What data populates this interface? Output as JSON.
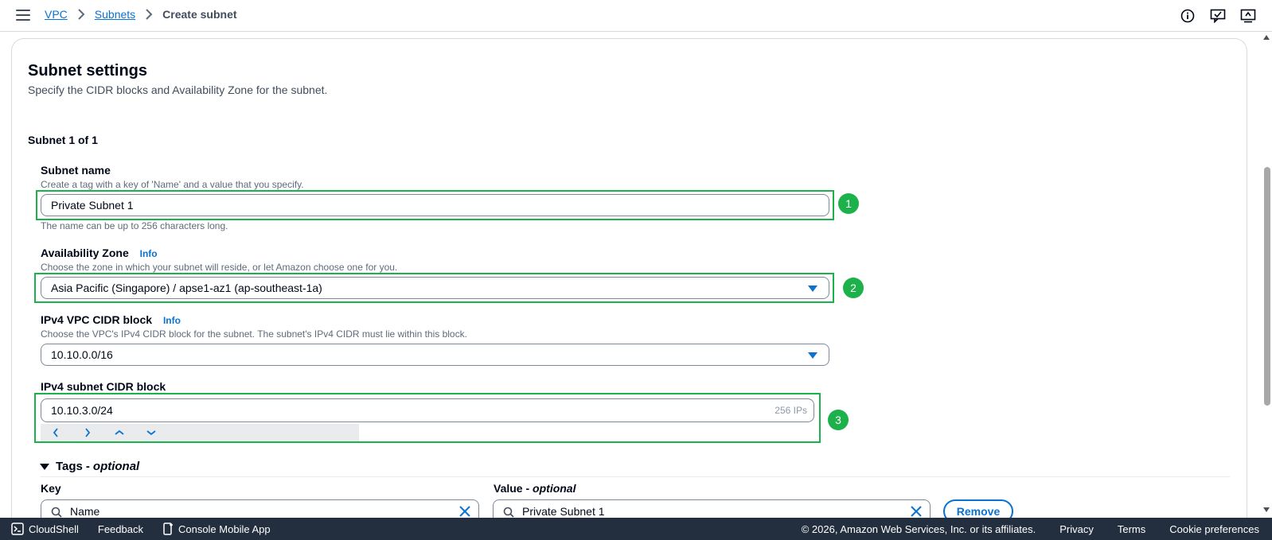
{
  "header": {
    "breadcrumb": {
      "vpc": "VPC",
      "subnets": "Subnets",
      "current": "Create subnet"
    },
    "icons": [
      "info-icon",
      "feedback-icon",
      "notifications-icon"
    ]
  },
  "section": {
    "title": "Subnet settings",
    "description": "Specify the CIDR blocks and Availability Zone for the subnet.",
    "subnet_count": "Subnet 1 of 1"
  },
  "subnet_name": {
    "label": "Subnet name",
    "description": "Create a tag with a key of 'Name' and a value that you specify.",
    "value": "Private Subnet 1",
    "constraint": "The name can be up to 256 characters long."
  },
  "availability_zone": {
    "label": "Availability Zone",
    "info": "Info",
    "description": "Choose the zone in which your subnet will reside, or let Amazon choose one for you.",
    "value": "Asia Pacific (Singapore) / apse1-az1 (ap-southeast-1a)"
  },
  "ipv4_vpc_cidr": {
    "label": "IPv4 VPC CIDR block",
    "info": "Info",
    "description": "Choose the VPC's IPv4 CIDR block for the subnet. The subnet's IPv4 CIDR must lie within this block.",
    "value": "10.10.0.0/16"
  },
  "ipv4_subnet_cidr": {
    "label": "IPv4 subnet CIDR block",
    "value": "10.10.3.0/24",
    "ip_count": "256 IPs"
  },
  "annotations": [
    "1",
    "2",
    "3"
  ],
  "tags": {
    "header": "Tags",
    "optional": "optional",
    "key_label": "Key",
    "value_label": "Value",
    "key_value": "Name",
    "value_value": "Private Subnet 1",
    "remove_label": "Remove"
  },
  "footer": {
    "cloudshell": "CloudShell",
    "feedback": "Feedback",
    "mobile_app": "Console Mobile App",
    "copyright": "© 2026, Amazon Web Services, Inc. or its affiliates.",
    "privacy": "Privacy",
    "terms": "Terms",
    "cookies": "Cookie preferences"
  },
  "colors": {
    "accent": "#0972d3",
    "highlight": "#1db14b",
    "footer_bg": "#232f3e"
  }
}
